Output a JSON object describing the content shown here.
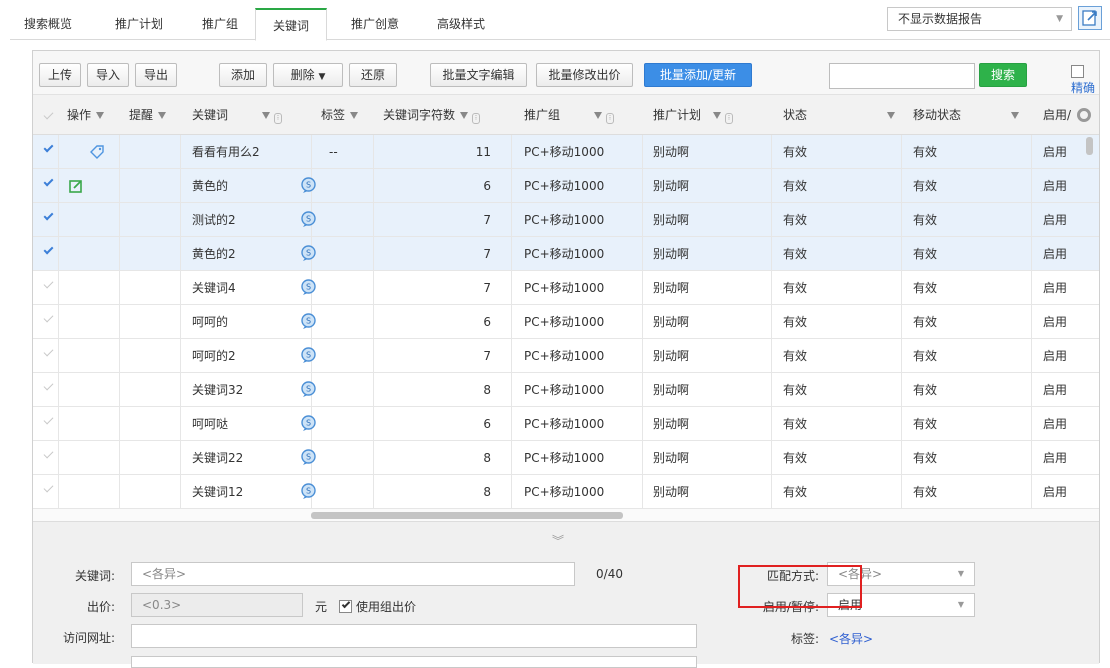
{
  "tabs": [
    {
      "label": "搜索概览",
      "active": false
    },
    {
      "label": "推广计划",
      "active": false
    },
    {
      "label": "推广组",
      "active": false
    },
    {
      "label": "关键词",
      "active": true
    },
    {
      "label": "推广创意",
      "active": false
    },
    {
      "label": "高级样式",
      "active": false
    }
  ],
  "report_select": {
    "value": "不显示数据报告",
    "arrow": "▼"
  },
  "toolbar": {
    "upload": "上传",
    "import": "导入",
    "export": "导出",
    "add": "添加",
    "delete": "删除",
    "delete_arrow": "▼",
    "restore": "还原",
    "batch_text_edit": "批量文字编辑",
    "batch_bid": "批量修改出价",
    "batch_add_update": "批量添加/更新",
    "search_button": "搜索",
    "search_placeholder": "",
    "exact_label": "精确"
  },
  "columns": [
    "操作",
    "提醒",
    "关键词",
    "标签",
    "关键词字符数",
    "推广组",
    "推广计划",
    "状态",
    "移动状态",
    "启用/暂"
  ],
  "rows": [
    {
      "selected": true,
      "op": "tag",
      "keyword": "看看有用么2",
      "tag": "--",
      "chars": "11",
      "group": "PC+移动1000",
      "plan": "别动啊",
      "status": "有效",
      "mobile": "有效",
      "enabled": "启用"
    },
    {
      "selected": true,
      "op": "edit",
      "keyword": "黄色的",
      "tag": "icon",
      "chars": "6",
      "group": "PC+移动1000",
      "plan": "别动啊",
      "status": "有效",
      "mobile": "有效",
      "enabled": "启用"
    },
    {
      "selected": true,
      "op": "",
      "keyword": "测试的2",
      "tag": "icon",
      "chars": "7",
      "group": "PC+移动1000",
      "plan": "别动啊",
      "status": "有效",
      "mobile": "有效",
      "enabled": "启用"
    },
    {
      "selected": true,
      "op": "",
      "keyword": "黄色的2",
      "tag": "icon",
      "chars": "7",
      "group": "PC+移动1000",
      "plan": "别动啊",
      "status": "有效",
      "mobile": "有效",
      "enabled": "启用"
    },
    {
      "selected": false,
      "op": "",
      "keyword": "关键词4",
      "tag": "icon",
      "chars": "7",
      "group": "PC+移动1000",
      "plan": "别动啊",
      "status": "有效",
      "mobile": "有效",
      "enabled": "启用"
    },
    {
      "selected": false,
      "op": "",
      "keyword": "呵呵的",
      "tag": "icon",
      "chars": "6",
      "group": "PC+移动1000",
      "plan": "别动啊",
      "status": "有效",
      "mobile": "有效",
      "enabled": "启用"
    },
    {
      "selected": false,
      "op": "",
      "keyword": "呵呵的2",
      "tag": "icon",
      "chars": "7",
      "group": "PC+移动1000",
      "plan": "别动啊",
      "status": "有效",
      "mobile": "有效",
      "enabled": "启用"
    },
    {
      "selected": false,
      "op": "",
      "keyword": "关键词32",
      "tag": "icon",
      "chars": "8",
      "group": "PC+移动1000",
      "plan": "别动啊",
      "status": "有效",
      "mobile": "有效",
      "enabled": "启用"
    },
    {
      "selected": false,
      "op": "",
      "keyword": "呵呵哒",
      "tag": "icon",
      "chars": "6",
      "group": "PC+移动1000",
      "plan": "别动啊",
      "status": "有效",
      "mobile": "有效",
      "enabled": "启用"
    },
    {
      "selected": false,
      "op": "",
      "keyword": "关键词22",
      "tag": "icon",
      "chars": "8",
      "group": "PC+移动1000",
      "plan": "别动啊",
      "status": "有效",
      "mobile": "有效",
      "enabled": "启用"
    },
    {
      "selected": false,
      "op": "",
      "keyword": "关键词12",
      "tag": "icon",
      "chars": "8",
      "group": "PC+移动1000",
      "plan": "别动啊",
      "status": "有效",
      "mobile": "有效",
      "enabled": "启用"
    }
  ],
  "form": {
    "collapse_glyph": "︾",
    "keyword_label": "关键词:",
    "keyword_value": "<各异>",
    "keyword_count": "0/40",
    "bid_label": "出价:",
    "bid_value": "<0.3>",
    "bid_unit": "元",
    "use_group_bid": "使用组出价",
    "url_label": "访问网址:",
    "url_value": "",
    "match_label": "匹配方式:",
    "match_value": "<各异>",
    "enable_label": "启用/暂停:",
    "enable_value": "启用",
    "tag_label": "标签:",
    "tag_value": "<各异>",
    "select_arrow": "▼"
  },
  "colors": {
    "accent_green": "#2eb24a",
    "primary_blue": "#3c8ee6",
    "selected_row": "#e8f1fb",
    "highlight_red": "#e02020"
  }
}
